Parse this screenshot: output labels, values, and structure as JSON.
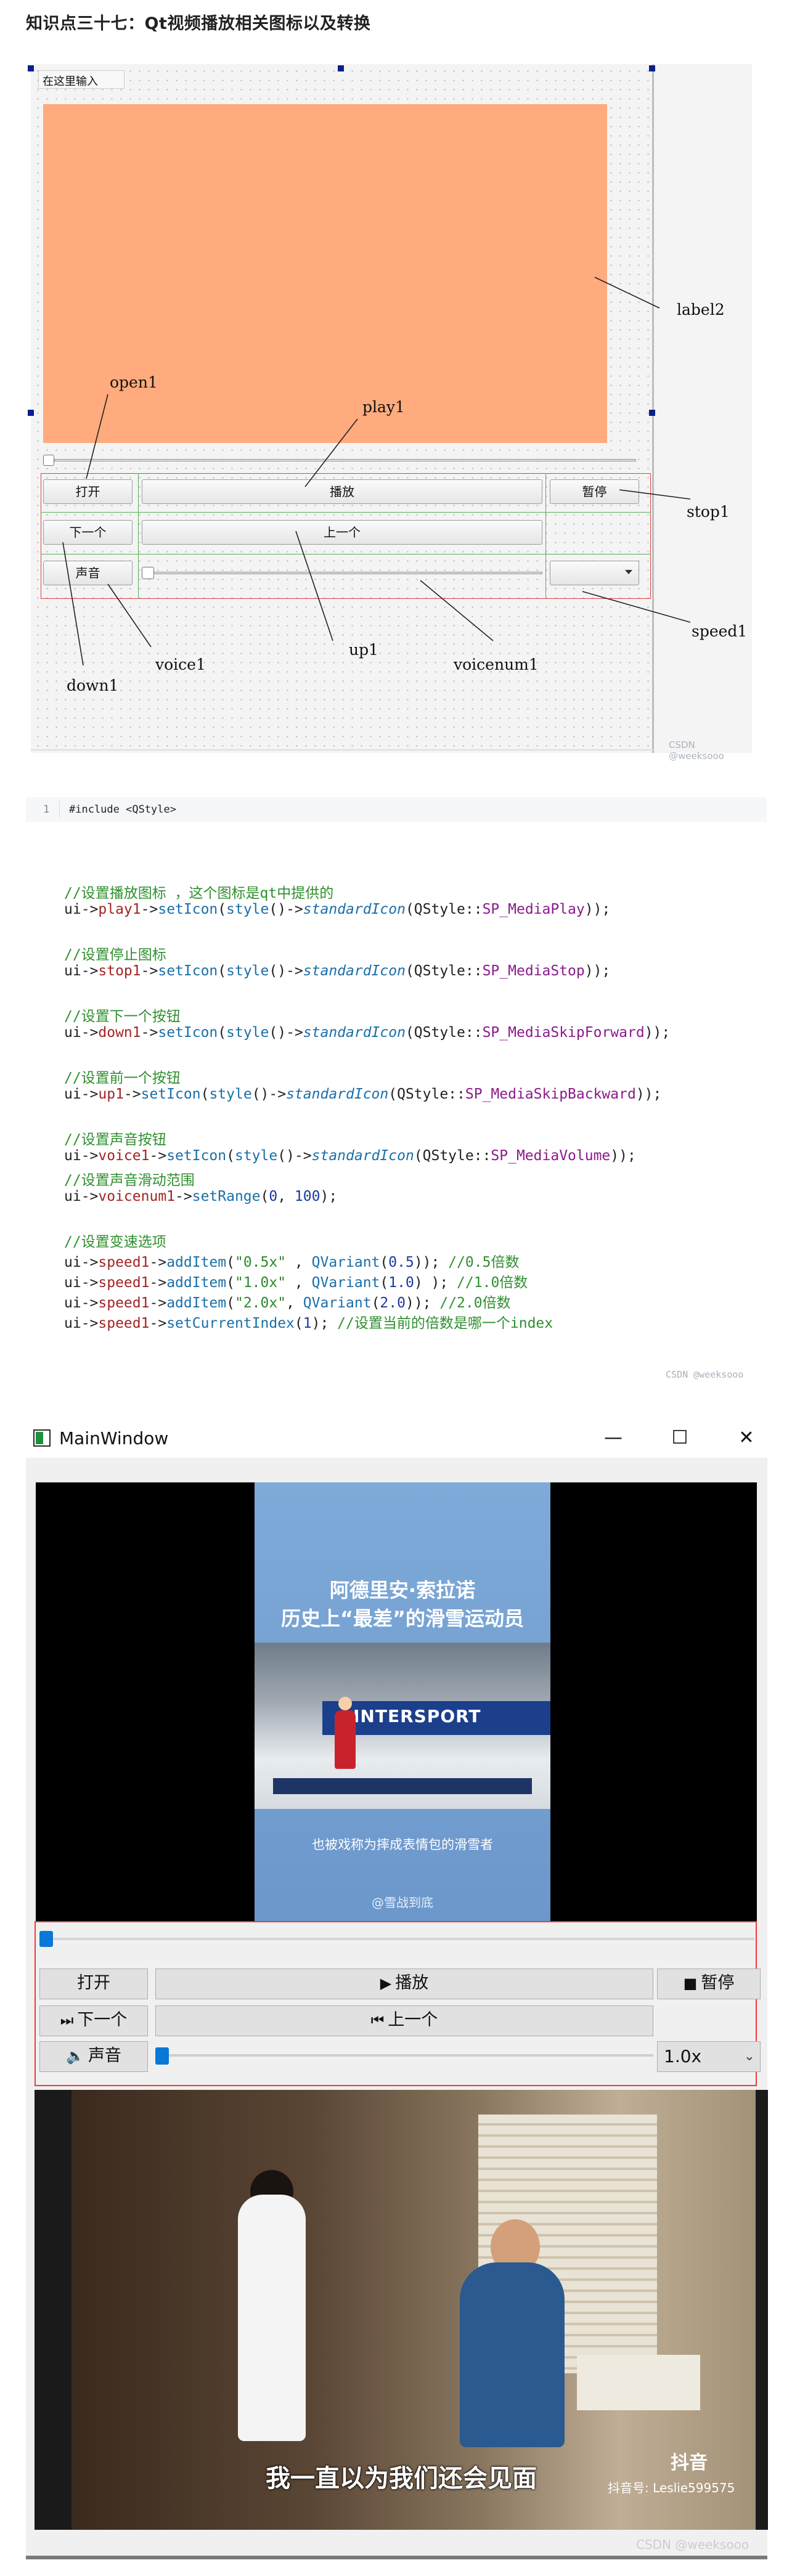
{
  "heading": "知识点三十七：Qt视频播放相关图标以及转换",
  "designer": {
    "line_edit_text": "在这里输入",
    "buttons": {
      "open": "打开",
      "play": "播放",
      "stop": "暂停",
      "down": "下一个",
      "up": "上一个",
      "voice": "声音"
    },
    "annotations": {
      "label2": "label2",
      "open1": "open1",
      "play1": "play1",
      "stop1": "stop1",
      "speed1": "speed1",
      "up1": "up1",
      "voicenum1": "voicenum1",
      "voice1": "voice1",
      "down1": "down1"
    },
    "watermark": "CSDN @weeksooo"
  },
  "code_include": {
    "line_number": "1",
    "text": "#include <QStyle>"
  },
  "code": {
    "c1": "//设置播放图标 ，这个图标是qt中提供的",
    "l1": {
      "a": "ui->",
      "b": "play1",
      "c": "->",
      "d": "setIcon",
      "e": "(",
      "f": "style",
      "g": "()->",
      "h": "standardIcon",
      "i": "(QStyle::",
      "j": "SP_MediaPlay",
      "k": "));"
    },
    "c2": "//设置停止图标",
    "l2": {
      "a": "ui->",
      "b": "stop1",
      "c": "->",
      "d": "setIcon",
      "e": "(",
      "f": "style",
      "g": "()->",
      "h": "standardIcon",
      "i": "(QStyle::",
      "j": "SP_MediaStop",
      "k": "));"
    },
    "c3": "//设置下一个按钮",
    "l3": {
      "a": "ui->",
      "b": "down1",
      "c": "->",
      "d": "setIcon",
      "e": "(",
      "f": "style",
      "g": "()->",
      "h": "standardIcon",
      "i": "(QStyle::",
      "j": "SP_MediaSkipForward",
      "k": "));"
    },
    "c4": "//设置前一个按钮",
    "l4": {
      "a": "ui->",
      "b": "up1",
      "c": "->",
      "d": "setIcon",
      "e": "(",
      "f": "style",
      "g": "()->",
      "h": "standardIcon",
      "i": "(QStyle::",
      "j": "SP_MediaSkipBackward",
      "k": "));"
    },
    "c5": "//设置声音按钮",
    "l5": {
      "a": "ui->",
      "b": "voice1",
      "c": "->",
      "d": "setIcon",
      "e": "(",
      "f": "style",
      "g": "()->",
      "h": "standardIcon",
      "i": "(QStyle::",
      "j": "SP_MediaVolume",
      "k": "));"
    },
    "c6": "//设置声音滑动范围",
    "l6": {
      "a": "ui->",
      "b": "voicenum1",
      "c": "->",
      "d": "setRange",
      "e": "(",
      "n1": "0",
      ",": ", ",
      "n2": "100",
      "k": ");"
    },
    "c7": "//设置变速选项",
    "s1": {
      "a": "ui->",
      "b": "speed1",
      "c": "->",
      "d": "addItem",
      "e": "(",
      "str": "\"0.5x\"",
      "m": " , ",
      "q": "QVariant",
      "p": "(",
      "num": "0.5",
      "k": "));",
      "com": " //0.5倍数"
    },
    "s2": {
      "a": "ui->",
      "b": "speed1",
      "c": "->",
      "d": "addItem",
      "e": "(",
      "str": "\"1.0x\"",
      "m": " , ",
      "q": "QVariant",
      "p": "(",
      "num": "1.0",
      "k": ") );",
      "com": " //1.0倍数"
    },
    "s3": {
      "a": "ui->",
      "b": "speed1",
      "c": "->",
      "d": "addItem",
      "e": "(",
      "str": "\"2.0x\"",
      "m": ", ",
      "q": "QVariant",
      "p": "(",
      "num": "2.0",
      "k": "));",
      "com": " //2.0倍数"
    },
    "s4": {
      "a": "ui->",
      "b": "speed1",
      "c": "->",
      "d": "setCurrentIndex",
      "e": "(",
      "num": "1",
      "k": ");",
      "com": " //设置当前的倍数是哪一个index"
    },
    "watermark": "CSDN @weeksooo"
  },
  "mainwindow": {
    "title": "MainWindow",
    "controls": {
      "minimize": "—",
      "maximize": "☐",
      "close": "✕"
    },
    "video1": {
      "headline1": "阿德里安·索拉诺",
      "headline2": "历史上“最差”的滑雪运动员",
      "banner": "INTERSPORT",
      "subtitle": "也被戏称为摔成表情包的滑雪者",
      "watermark": "@雪战到底"
    },
    "position_slider": 0.0,
    "buttons": {
      "open": "打开",
      "play": "播放",
      "stop": "暂停",
      "next": "下一个",
      "prev": "上一个",
      "voice": "声音"
    },
    "icons": {
      "play": "▶",
      "stop": "■",
      "next": "⏭",
      "prev": "⏮",
      "voice": "🔈"
    },
    "volume_slider": 0.0,
    "speed": "1.0x",
    "video2": {
      "subtitle": "我一直以为我们还会见面",
      "logo": "抖音",
      "account": "抖音号: Leslie599575"
    },
    "watermark": "CSDN @weeksooo"
  },
  "colors": {
    "label_fill": "#ffab7d",
    "red_outline": "#e04040",
    "slider_knob": "#0a78d7",
    "comment_green": "#2f8f2f",
    "member_red": "#a32424",
    "func_blue": "#1a6fa8",
    "enum_purple": "#8b1a8b"
  }
}
